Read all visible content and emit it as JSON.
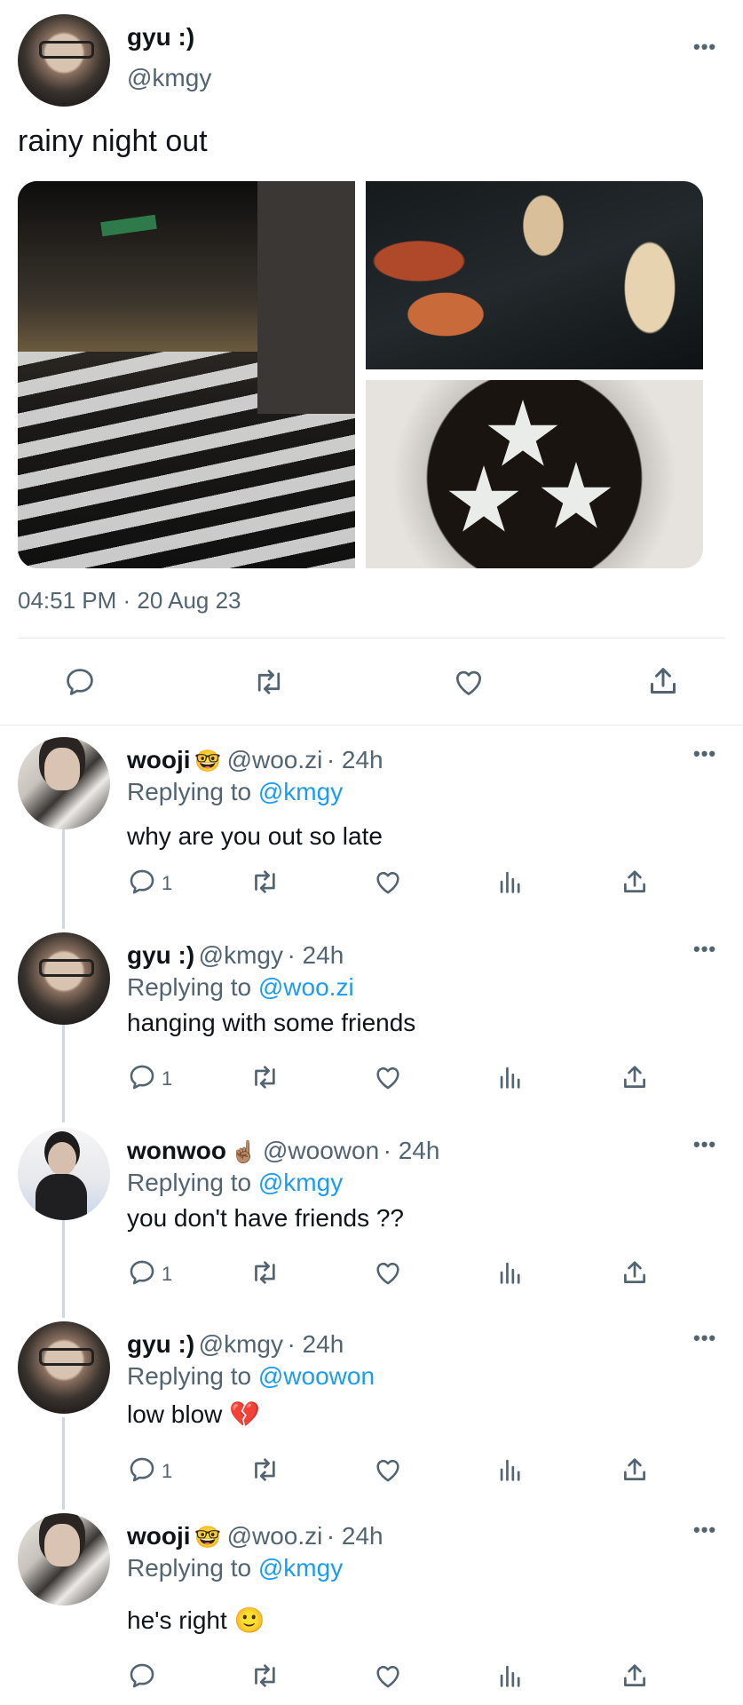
{
  "main_tweet": {
    "name": "gyu :)",
    "handle": "@kmgy",
    "text": "rainy night out",
    "timestamp": "04:51 PM · 20 Aug 23",
    "more": "•••"
  },
  "replies": [
    {
      "name": "wooji",
      "emoji": "🤓",
      "handle": "@woo.zi",
      "time": "· 24h",
      "replying_prefix": "Replying to ",
      "replying_to": "@kmgy",
      "text": "why are you out so late",
      "reply_count": "1",
      "more": "•••"
    },
    {
      "name": "gyu :)",
      "emoji": "",
      "handle": "@kmgy",
      "time": "· 24h",
      "replying_prefix": "Replying to ",
      "replying_to": "@woo.zi",
      "text": "hanging with some friends",
      "reply_count": "1",
      "more": "•••"
    },
    {
      "name": "wonwoo",
      "emoji": "☝🏽",
      "handle": "@woowon",
      "time": "· 24h",
      "replying_prefix": "Replying to ",
      "replying_to": "@kmgy",
      "text": "you don't have friends ??",
      "reply_count": "1",
      "more": "•••"
    },
    {
      "name": "gyu :)",
      "emoji": "",
      "handle": "@kmgy",
      "time": "· 24h",
      "replying_prefix": "Replying to ",
      "replying_to": "@woowon",
      "text": "low blow 💔",
      "reply_count": "1",
      "more": "•••"
    },
    {
      "name": "wooji",
      "emoji": "🤓",
      "handle": "@woo.zi",
      "time": "· 24h",
      "replying_prefix": "Replying to ",
      "replying_to": "@kmgy",
      "text": "he's right 🙂",
      "reply_count": "",
      "more": "•••"
    }
  ],
  "icons": {
    "reply": "reply-icon",
    "retweet": "retweet-icon",
    "like": "heart-icon",
    "views": "views-icon",
    "share": "share-icon"
  },
  "colors": {
    "mention": "#1d9bf0",
    "secondary": "#536471",
    "text": "#0f1419"
  }
}
